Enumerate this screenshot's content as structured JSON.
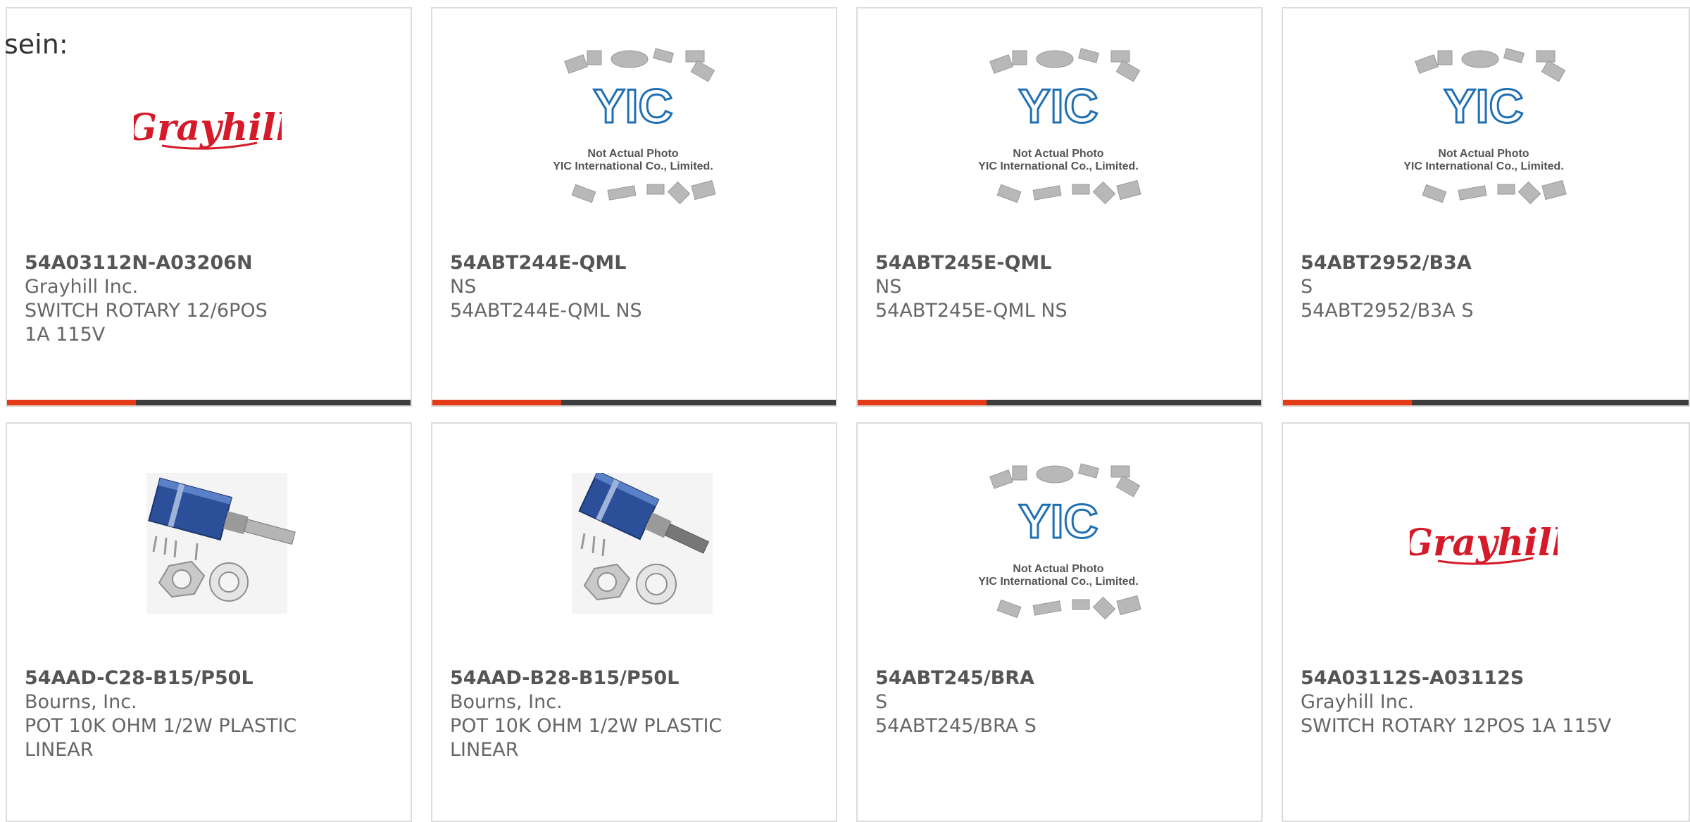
{
  "prefix_text": "sein:",
  "brand_colors": {
    "accent": "#e23b16",
    "bar": "#3d3d3d",
    "grayhill_red": "#d51b2a",
    "yic_blue": "#1f6fb3"
  },
  "placeholder": {
    "logo_text": "YIC",
    "line1": "Not Actual Photo",
    "line2": "YIC International Co., Limited."
  },
  "grayhill_logo_text": "Grayhill",
  "products": [
    {
      "part_number": "54A03112N-A03206N",
      "manufacturer": "Grayhill Inc.",
      "description": "SWITCH ROTARY 12/6POS 1A 115V",
      "image": "grayhill-logo"
    },
    {
      "part_number": "54ABT244E-QML",
      "manufacturer": "NS",
      "description": "54ABT244E-QML NS",
      "image": "not-actual-photo"
    },
    {
      "part_number": "54ABT245E-QML",
      "manufacturer": "NS",
      "description": "54ABT245E-QML NS",
      "image": "not-actual-photo"
    },
    {
      "part_number": "54ABT2952/B3A",
      "manufacturer": "S",
      "description": "54ABT2952/B3A S",
      "image": "not-actual-photo"
    },
    {
      "part_number": "54AAD-C28-B15/P50L",
      "manufacturer": "Bourns, Inc.",
      "description": "POT 10K OHM 1/2W PLASTIC LINEAR",
      "image": "potentiometer-photo"
    },
    {
      "part_number": "54AAD-B28-B15/P50L",
      "manufacturer": "Bourns, Inc.",
      "description": "POT 10K OHM 1/2W PLASTIC LINEAR",
      "image": "potentiometer-photo"
    },
    {
      "part_number": "54ABT245/BRA",
      "manufacturer": "S",
      "description": "54ABT245/BRA S",
      "image": "not-actual-photo"
    },
    {
      "part_number": "54A03112S-A03112S",
      "manufacturer": "Grayhill Inc.",
      "description": "SWITCH ROTARY 12POS 1A 115V",
      "image": "grayhill-logo"
    }
  ]
}
